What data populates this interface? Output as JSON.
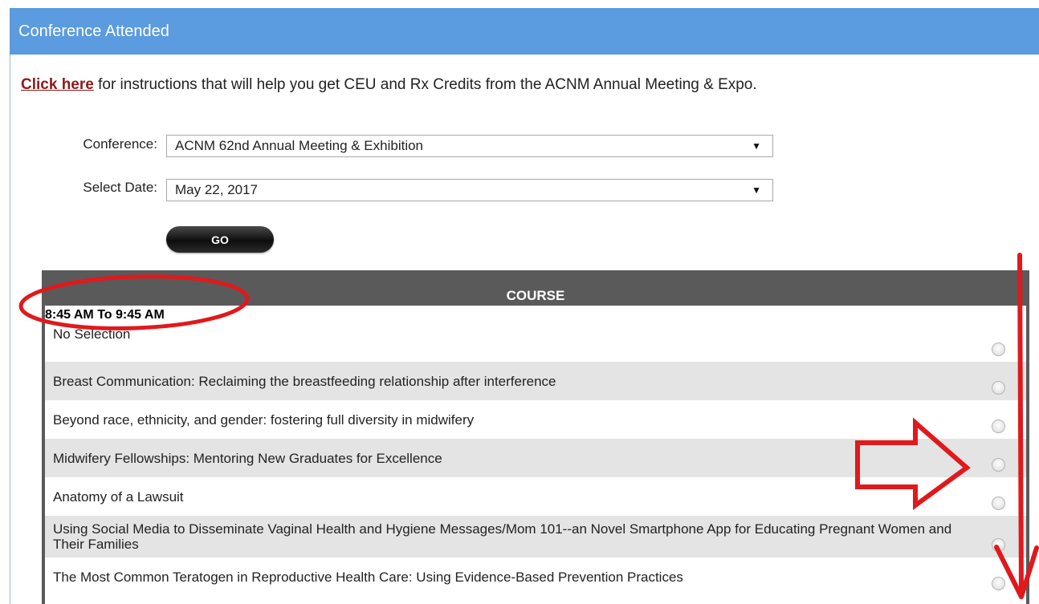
{
  "header": {
    "title": "Conference Attended"
  },
  "intro": {
    "link_text": "Click here",
    "text": " for instructions that will help you get CEU and Rx Credits from the ACNM Annual Meeting & Expo."
  },
  "form": {
    "conference_label": "Conference:",
    "conference_value": "ACNM 62nd Annual Meeting & Exhibition",
    "date_label": "Select Date:",
    "date_value": "May 22, 2017",
    "dropdown_arrow": "▼",
    "go_label": "GO"
  },
  "table": {
    "header": "COURSE",
    "time_slot": "8:45 AM To 9:45 AM",
    "rows": [
      {
        "label": "No Selection"
      },
      {
        "label": "Breast Communication: Reclaiming the breastfeeding relationship after interference"
      },
      {
        "label": "Beyond race, ethnicity, and gender: fostering full diversity in midwifery"
      },
      {
        "label": "Midwifery Fellowships: Mentoring New Graduates for Excellence"
      },
      {
        "label": "Anatomy of a Lawsuit"
      },
      {
        "label": "Using Social Media to Disseminate Vaginal Health and Hygiene Messages/Mom 101--an Novel Smartphone App for Educating Pregnant Women and Their Families"
      },
      {
        "label": "The Most Common Teratogen in Reproductive Health Care: Using Evidence-Based Prevention Practices"
      }
    ]
  },
  "colors": {
    "header_bg": "#5b9bdf",
    "link": "#8b1a1a",
    "table_head": "#5a5a5a",
    "row_alt": "#e4e4e4",
    "annotation": "#e0191c"
  }
}
